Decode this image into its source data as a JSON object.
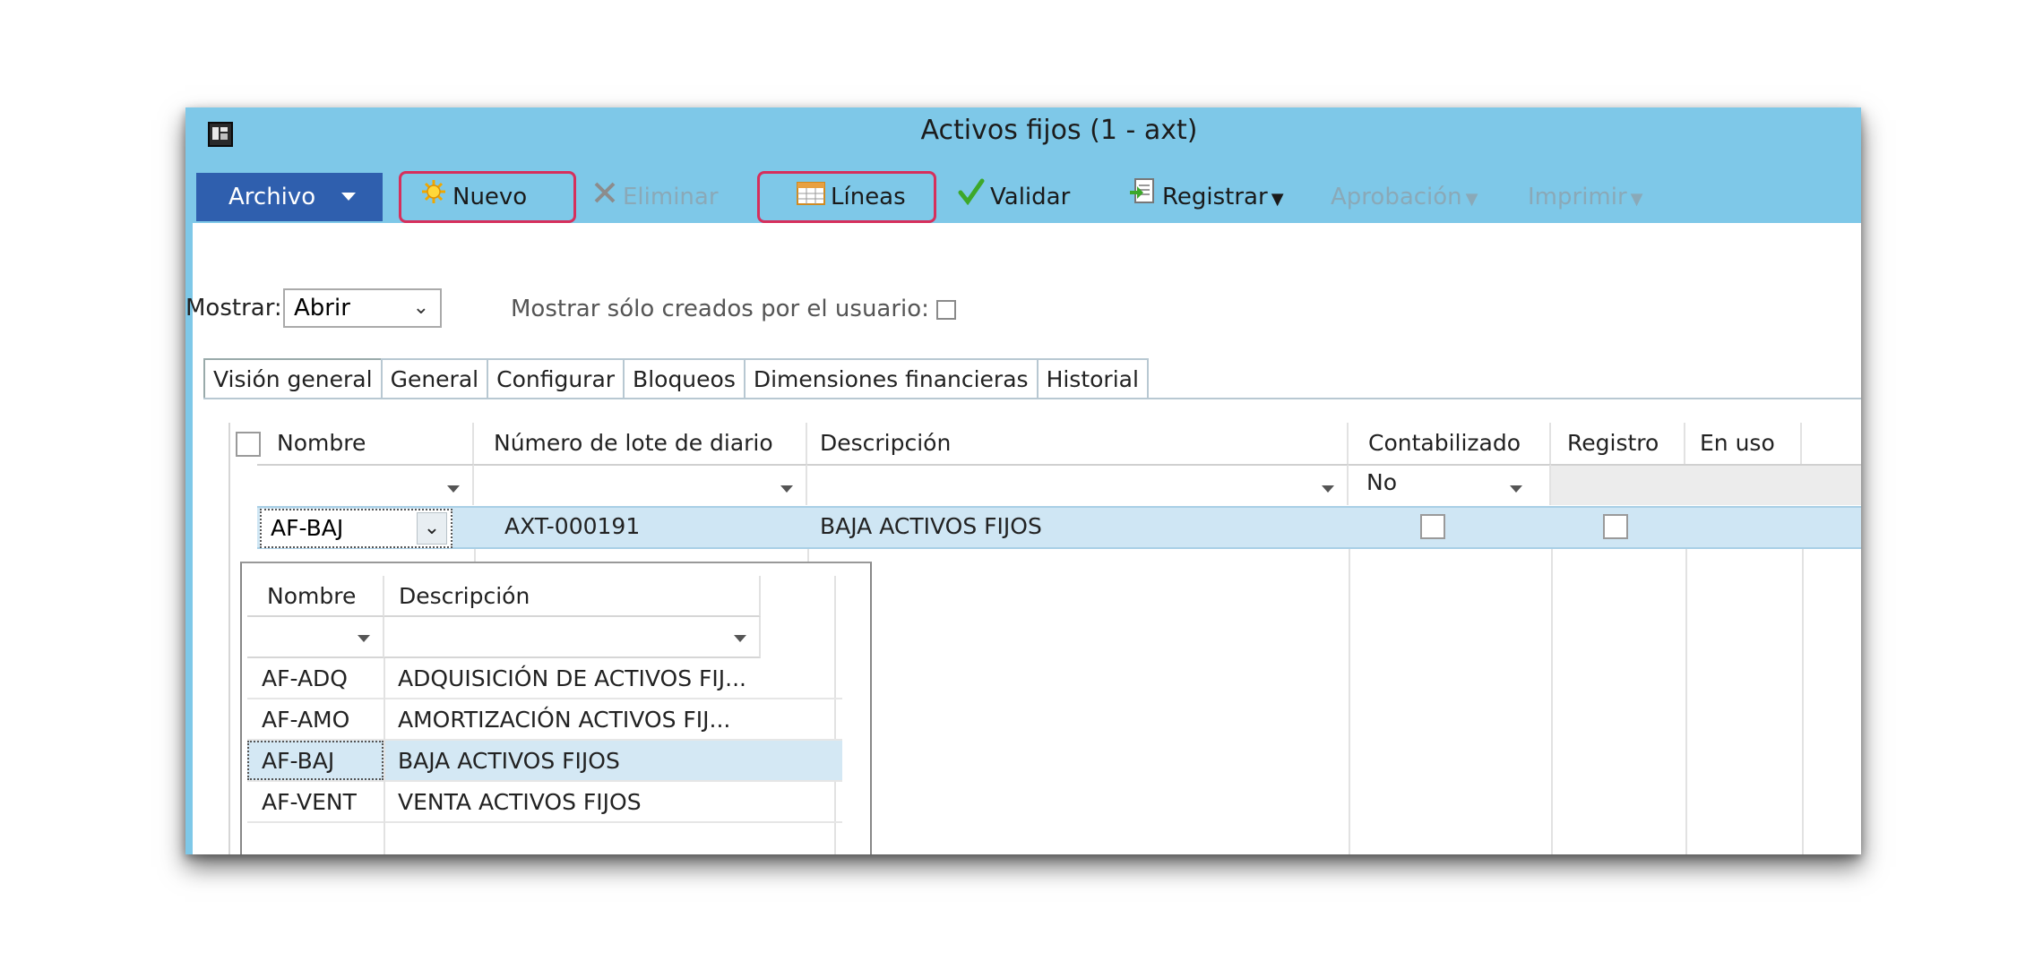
{
  "window": {
    "title": "Activos fijos (1 - axt)"
  },
  "toolbar": {
    "archivo": "Archivo",
    "nuevo": "Nuevo",
    "eliminar": "Eliminar",
    "lineas": "Líneas",
    "validar": "Validar",
    "registrar": "Registrar",
    "aprobacion": "Aprobación",
    "imprimir": "Imprimir"
  },
  "filter": {
    "mostrar_label": "Mostrar:",
    "mostrar_value": "Abrir",
    "only_user_label": "Mostrar sólo creados por el usuario:"
  },
  "tabs": [
    "Visión general",
    "General",
    "Configurar",
    "Bloqueos",
    "Dimensiones financieras",
    "Historial"
  ],
  "grid": {
    "columns": [
      "Nombre",
      "Número de lote de diario",
      "Descripción",
      "Contabilizado",
      "Registro",
      "En uso"
    ],
    "contabilizado_filter": "No",
    "row": {
      "nombre": "AF-BAJ",
      "lote": "AXT-000191",
      "descripcion": "BAJA ACTIVOS FIJOS"
    }
  },
  "lookup": {
    "columns": [
      "Nombre",
      "Descripción"
    ],
    "rows": [
      {
        "nombre": "AF-ADQ",
        "descripcion": "ADQUISICIÓN DE ACTIVOS FIJ..."
      },
      {
        "nombre": "AF-AMO",
        "descripcion": "AMORTIZACIÓN ACTIVOS FIJ..."
      },
      {
        "nombre": "AF-BAJ",
        "descripcion": "BAJA ACTIVOS FIJOS"
      },
      {
        "nombre": "AF-VENT",
        "descripcion": "VENTA ACTIVOS FIJOS"
      }
    ],
    "selected_index": 2
  },
  "colors": {
    "titlebar": "#7ec8e8",
    "archivo_button": "#2f5fae",
    "highlight_box": "#d62f5c",
    "selected_row": "#cfe6f4"
  },
  "icons": {
    "nuevo": "sun-star-icon",
    "eliminar": "x-delete-icon",
    "lineas": "grid-lines-icon",
    "validar": "checkmark-icon",
    "registrar": "post-document-icon"
  }
}
